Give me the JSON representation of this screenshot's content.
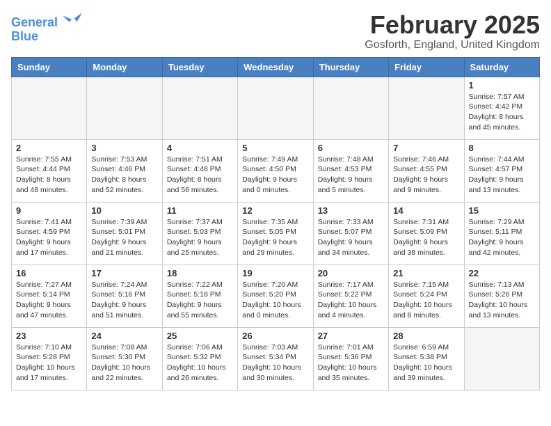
{
  "header": {
    "logo_general": "General",
    "logo_blue": "Blue",
    "title": "February 2025",
    "subtitle": "Gosforth, England, United Kingdom"
  },
  "weekdays": [
    "Sunday",
    "Monday",
    "Tuesday",
    "Wednesday",
    "Thursday",
    "Friday",
    "Saturday"
  ],
  "weeks": [
    [
      {
        "day": "",
        "info": ""
      },
      {
        "day": "",
        "info": ""
      },
      {
        "day": "",
        "info": ""
      },
      {
        "day": "",
        "info": ""
      },
      {
        "day": "",
        "info": ""
      },
      {
        "day": "",
        "info": ""
      },
      {
        "day": "1",
        "info": "Sunrise: 7:57 AM\nSunset: 4:42 PM\nDaylight: 8 hours and 45 minutes."
      }
    ],
    [
      {
        "day": "2",
        "info": "Sunrise: 7:55 AM\nSunset: 4:44 PM\nDaylight: 8 hours and 48 minutes."
      },
      {
        "day": "3",
        "info": "Sunrise: 7:53 AM\nSunset: 4:46 PM\nDaylight: 8 hours and 52 minutes."
      },
      {
        "day": "4",
        "info": "Sunrise: 7:51 AM\nSunset: 4:48 PM\nDaylight: 8 hours and 56 minutes."
      },
      {
        "day": "5",
        "info": "Sunrise: 7:49 AM\nSunset: 4:50 PM\nDaylight: 9 hours and 0 minutes."
      },
      {
        "day": "6",
        "info": "Sunrise: 7:48 AM\nSunset: 4:53 PM\nDaylight: 9 hours and 5 minutes."
      },
      {
        "day": "7",
        "info": "Sunrise: 7:46 AM\nSunset: 4:55 PM\nDaylight: 9 hours and 9 minutes."
      },
      {
        "day": "8",
        "info": "Sunrise: 7:44 AM\nSunset: 4:57 PM\nDaylight: 9 hours and 13 minutes."
      }
    ],
    [
      {
        "day": "9",
        "info": "Sunrise: 7:41 AM\nSunset: 4:59 PM\nDaylight: 9 hours and 17 minutes."
      },
      {
        "day": "10",
        "info": "Sunrise: 7:39 AM\nSunset: 5:01 PM\nDaylight: 9 hours and 21 minutes."
      },
      {
        "day": "11",
        "info": "Sunrise: 7:37 AM\nSunset: 5:03 PM\nDaylight: 9 hours and 25 minutes."
      },
      {
        "day": "12",
        "info": "Sunrise: 7:35 AM\nSunset: 5:05 PM\nDaylight: 9 hours and 29 minutes."
      },
      {
        "day": "13",
        "info": "Sunrise: 7:33 AM\nSunset: 5:07 PM\nDaylight: 9 hours and 34 minutes."
      },
      {
        "day": "14",
        "info": "Sunrise: 7:31 AM\nSunset: 5:09 PM\nDaylight: 9 hours and 38 minutes."
      },
      {
        "day": "15",
        "info": "Sunrise: 7:29 AM\nSunset: 5:11 PM\nDaylight: 9 hours and 42 minutes."
      }
    ],
    [
      {
        "day": "16",
        "info": "Sunrise: 7:27 AM\nSunset: 5:14 PM\nDaylight: 9 hours and 47 minutes."
      },
      {
        "day": "17",
        "info": "Sunrise: 7:24 AM\nSunset: 5:16 PM\nDaylight: 9 hours and 51 minutes."
      },
      {
        "day": "18",
        "info": "Sunrise: 7:22 AM\nSunset: 5:18 PM\nDaylight: 9 hours and 55 minutes."
      },
      {
        "day": "19",
        "info": "Sunrise: 7:20 AM\nSunset: 5:20 PM\nDaylight: 10 hours and 0 minutes."
      },
      {
        "day": "20",
        "info": "Sunrise: 7:17 AM\nSunset: 5:22 PM\nDaylight: 10 hours and 4 minutes."
      },
      {
        "day": "21",
        "info": "Sunrise: 7:15 AM\nSunset: 5:24 PM\nDaylight: 10 hours and 8 minutes."
      },
      {
        "day": "22",
        "info": "Sunrise: 7:13 AM\nSunset: 5:26 PM\nDaylight: 10 hours and 13 minutes."
      }
    ],
    [
      {
        "day": "23",
        "info": "Sunrise: 7:10 AM\nSunset: 5:28 PM\nDaylight: 10 hours and 17 minutes."
      },
      {
        "day": "24",
        "info": "Sunrise: 7:08 AM\nSunset: 5:30 PM\nDaylight: 10 hours and 22 minutes."
      },
      {
        "day": "25",
        "info": "Sunrise: 7:06 AM\nSunset: 5:32 PM\nDaylight: 10 hours and 26 minutes."
      },
      {
        "day": "26",
        "info": "Sunrise: 7:03 AM\nSunset: 5:34 PM\nDaylight: 10 hours and 30 minutes."
      },
      {
        "day": "27",
        "info": "Sunrise: 7:01 AM\nSunset: 5:36 PM\nDaylight: 10 hours and 35 minutes."
      },
      {
        "day": "28",
        "info": "Sunrise: 6:59 AM\nSunset: 5:38 PM\nDaylight: 10 hours and 39 minutes."
      },
      {
        "day": "",
        "info": ""
      }
    ]
  ]
}
